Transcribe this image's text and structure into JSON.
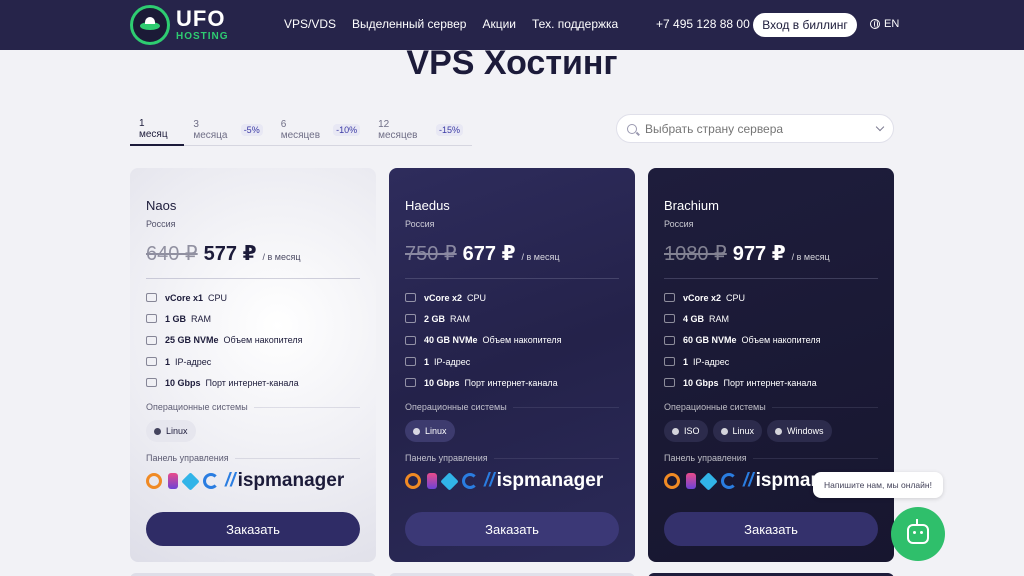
{
  "header": {
    "logo_main": "UFO",
    "logo_sub": "HOSTING",
    "nav": [
      "VPS/VDS",
      "Выделенный сервер",
      "Акции",
      "Тех. поддержка"
    ],
    "phone": "+7 495 128 88 00",
    "billing_label": "Вход в биллинг",
    "lang": "EN"
  },
  "page": {
    "title": "VPS Хостинг"
  },
  "period_tabs": [
    {
      "label": "1 месяц",
      "discount": ""
    },
    {
      "label": "3 месяца",
      "discount": "-5%"
    },
    {
      "label": "6 месяцев",
      "discount": "-10%"
    },
    {
      "label": "12 месяцев",
      "discount": "-15%"
    }
  ],
  "country_select": {
    "placeholder": "Выбрать страну сервера"
  },
  "labels": {
    "per_month": "/ в месяц",
    "os_section": "Операционные системы",
    "panel_section": "Панель управления",
    "panel_brand": "ispmanager",
    "order": "Заказать",
    "cpu": "CPU",
    "ram": "RAM",
    "disk": "Объем накопителя",
    "ip": "IP-адрес",
    "port": "Порт интернет-канала"
  },
  "plans": [
    {
      "name": "Naos",
      "country": "Россия",
      "old_price": "640 ₽",
      "price": "577 ₽",
      "cpu": "vCore x1",
      "ram": "1 GB",
      "disk": "25 GB NVMe",
      "ip": "1",
      "port": "10 Gbps",
      "os": [
        "Linux"
      ]
    },
    {
      "name": "Haedus",
      "country": "Россия",
      "old_price": "750 ₽",
      "price": "677 ₽",
      "cpu": "vCore x2",
      "ram": "2 GB",
      "disk": "40 GB NVMe",
      "ip": "1",
      "port": "10 Gbps",
      "os": [
        "Linux"
      ]
    },
    {
      "name": "Brachium",
      "country": "Россия",
      "old_price": "1080 ₽",
      "price": "977 ₽",
      "cpu": "vCore x2",
      "ram": "4 GB",
      "disk": "60 GB NVMe",
      "ip": "1",
      "port": "10 Gbps",
      "os": [
        "ISO",
        "Linux",
        "Windows"
      ]
    }
  ],
  "chat": {
    "tooltip": "Напишите нам, мы онлайн!"
  }
}
